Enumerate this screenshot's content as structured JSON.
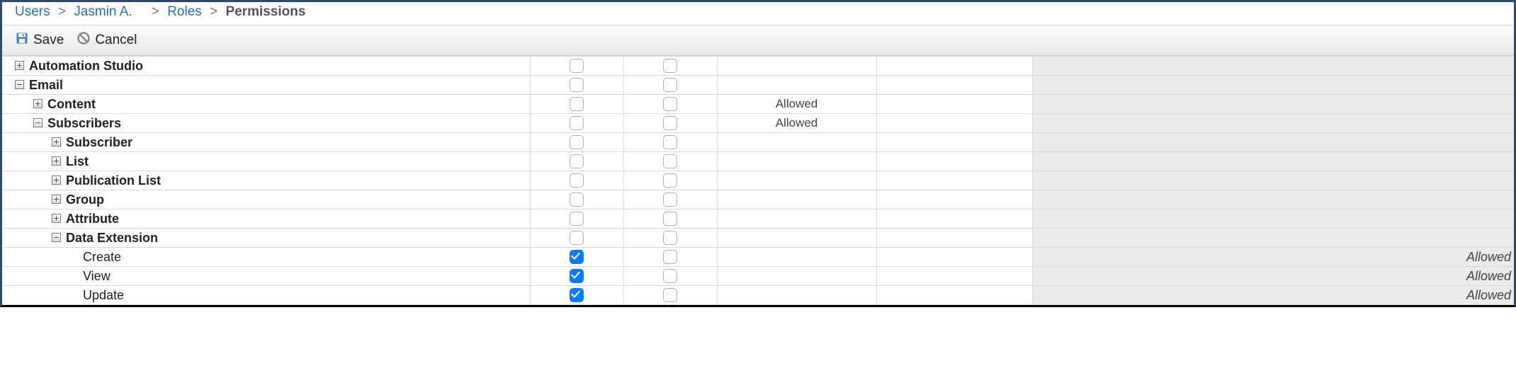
{
  "breadcrumb": {
    "users": "Users",
    "user_name": "Jasmin A.",
    "roles": "Roles",
    "current": "Permissions"
  },
  "toolbar": {
    "save_label": "Save",
    "cancel_label": "Cancel"
  },
  "rows": [
    {
      "indent": 0,
      "toggle": "plus",
      "label": "Automation Studio",
      "leaf": false,
      "c1": false,
      "c2": false,
      "status": "",
      "right": ""
    },
    {
      "indent": 0,
      "toggle": "minus",
      "label": "Email",
      "leaf": false,
      "c1": false,
      "c2": false,
      "status": "",
      "right": ""
    },
    {
      "indent": 1,
      "toggle": "plus",
      "label": "Content",
      "leaf": false,
      "c1": false,
      "c2": false,
      "status": "Allowed",
      "right": ""
    },
    {
      "indent": 1,
      "toggle": "minus",
      "label": "Subscribers",
      "leaf": false,
      "c1": false,
      "c2": false,
      "status": "Allowed",
      "right": ""
    },
    {
      "indent": 2,
      "toggle": "plus",
      "label": "Subscriber",
      "leaf": false,
      "c1": false,
      "c2": false,
      "status": "",
      "right": ""
    },
    {
      "indent": 2,
      "toggle": "plus",
      "label": "List",
      "leaf": false,
      "c1": false,
      "c2": false,
      "status": "",
      "right": ""
    },
    {
      "indent": 2,
      "toggle": "plus",
      "label": "Publication List",
      "leaf": false,
      "c1": false,
      "c2": false,
      "status": "",
      "right": ""
    },
    {
      "indent": 2,
      "toggle": "plus",
      "label": "Group",
      "leaf": false,
      "c1": false,
      "c2": false,
      "status": "",
      "right": ""
    },
    {
      "indent": 2,
      "toggle": "plus",
      "label": "Attribute",
      "leaf": false,
      "c1": false,
      "c2": false,
      "status": "",
      "right": ""
    },
    {
      "indent": 2,
      "toggle": "minus",
      "label": "Data Extension",
      "leaf": false,
      "c1": false,
      "c2": false,
      "status": "",
      "right": ""
    },
    {
      "indent": 3,
      "toggle": "none",
      "label": "Create",
      "leaf": true,
      "c1": true,
      "c2": false,
      "status": "",
      "right": "Allowed"
    },
    {
      "indent": 3,
      "toggle": "none",
      "label": "View",
      "leaf": true,
      "c1": true,
      "c2": false,
      "status": "",
      "right": "Allowed"
    },
    {
      "indent": 3,
      "toggle": "none",
      "label": "Update",
      "leaf": true,
      "c1": true,
      "c2": false,
      "status": "",
      "right": "Allowed"
    }
  ]
}
